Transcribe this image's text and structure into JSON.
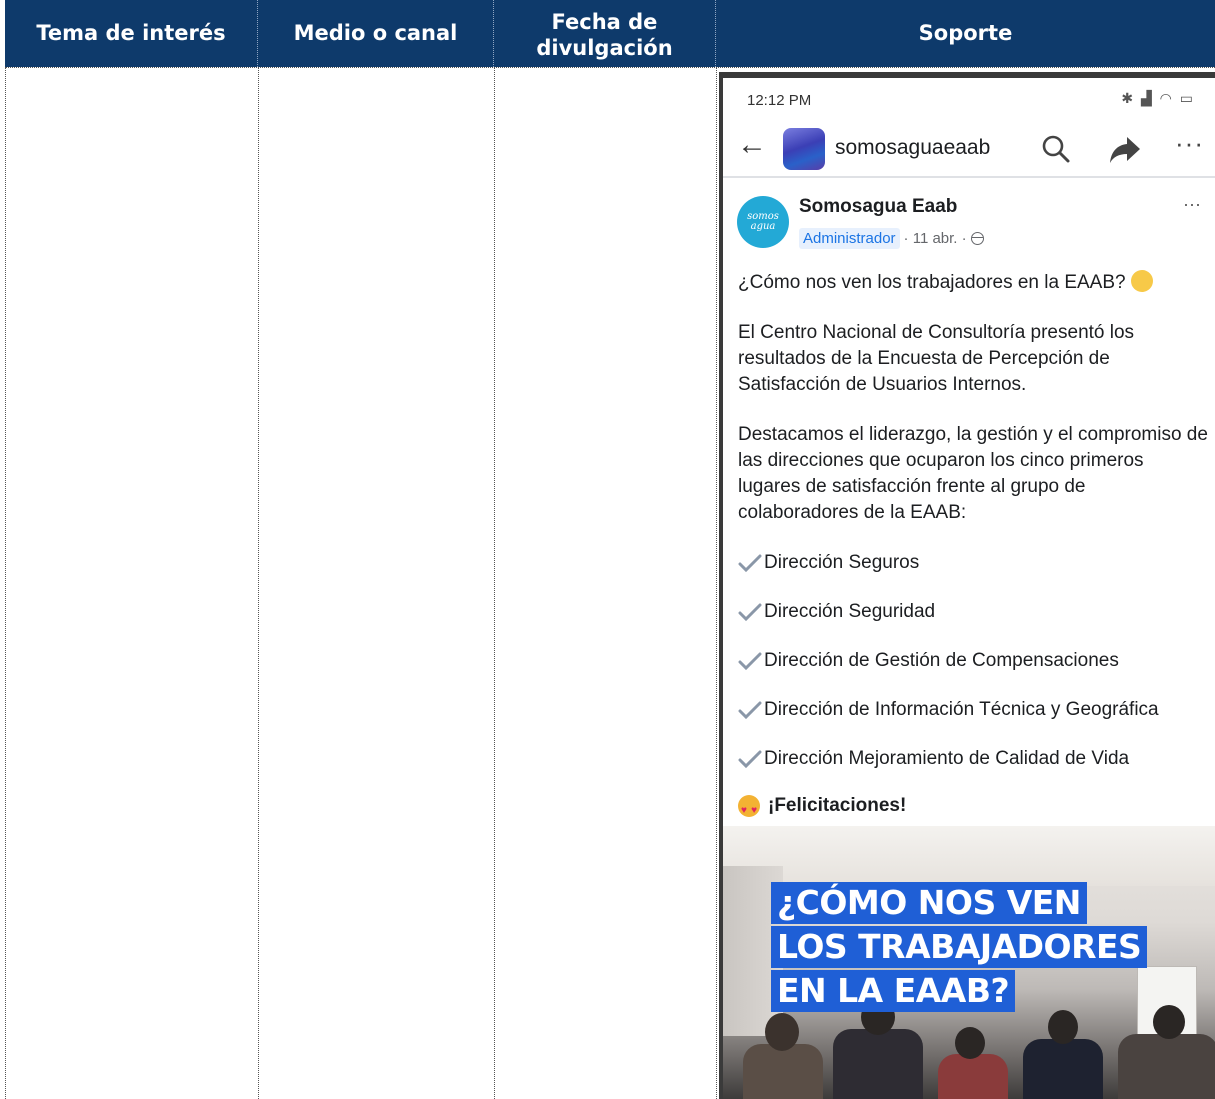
{
  "table": {
    "headers": [
      "Tema de interés",
      "Medio o canal",
      "Fecha de divulgación",
      "Soporte"
    ],
    "header_lines_col3": [
      "Fecha de",
      "divulgación"
    ]
  },
  "phone": {
    "status_time": "12:12 PM",
    "page_name": "somosaguaeaab",
    "post": {
      "avatar_text": "somos agua",
      "author": "Somosagua Eaab",
      "role_badge": "Administrador",
      "date": "· 11 abr. ·",
      "paragraphs": [
        "¿Cómo nos ven los trabajadores en la EAAB?",
        "El Centro Nacional de Consultoría presentó los resultados de la Encuesta de Percepción de Satisfacción de Usuarios Internos.",
        "Destacamos el liderazgo, la gestión y el compromiso de las direcciones que ocuparon los cinco primeros lugares de satisfacción frente al grupo de colaboradores de la EAAB:"
      ],
      "list_items": [
        "Dirección Seguros",
        "Dirección Seguridad",
        "Dirección de Gestión de Compensaciones",
        "Dirección de Información Técnica y Geográfica",
        "Dirección Mejoramiento de Calidad de Vida"
      ],
      "closing": "¡Felicitaciones!",
      "image_headline": [
        "¿CÓMO NOS VEN",
        "LOS TRABAJADORES",
        "EN LA EAAB?"
      ]
    }
  },
  "colors": {
    "header_bg": "#0e3a6b",
    "badge_blue": "#1b74e4",
    "headline_bg": "#1f5fd6"
  }
}
